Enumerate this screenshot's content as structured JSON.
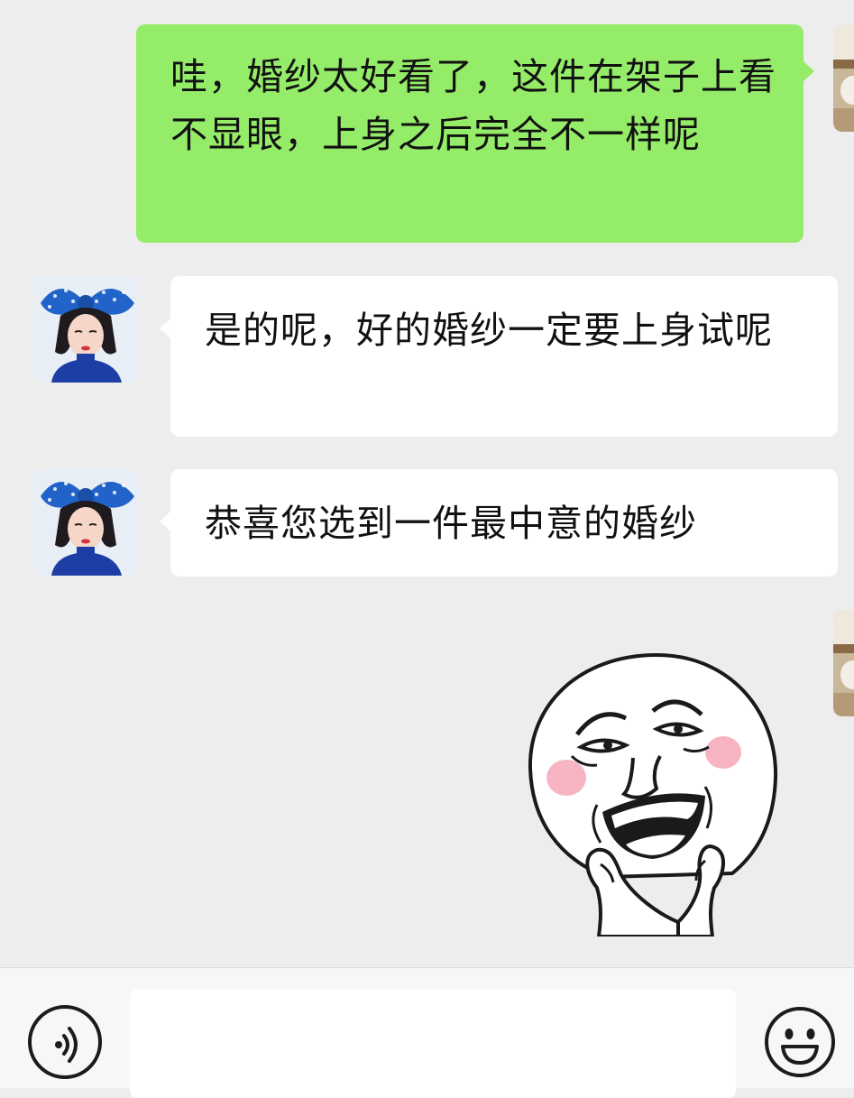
{
  "conversation": {
    "messages": [
      {
        "direction": "outgoing",
        "type": "text",
        "text": "哇，婚纱太好看了，这件在架子上看不显眼，上身之后完全不一样呢"
      },
      {
        "direction": "incoming",
        "type": "text",
        "text": "是的呢，好的婚纱一定要上身试呢"
      },
      {
        "direction": "incoming",
        "type": "text",
        "text": "恭喜您选到一件最中意的婚纱"
      },
      {
        "direction": "outgoing",
        "type": "sticker",
        "sticker": "laughing-face-sticker"
      }
    ]
  },
  "input_bar": {
    "voice_icon": "voice-icon",
    "message_value": "",
    "emoji_icon": "emoji-icon"
  },
  "colors": {
    "background": "#ededed",
    "outgoing_bubble": "#95ec69",
    "incoming_bubble": "#ffffff",
    "input_bar": "#f7f7f7"
  }
}
